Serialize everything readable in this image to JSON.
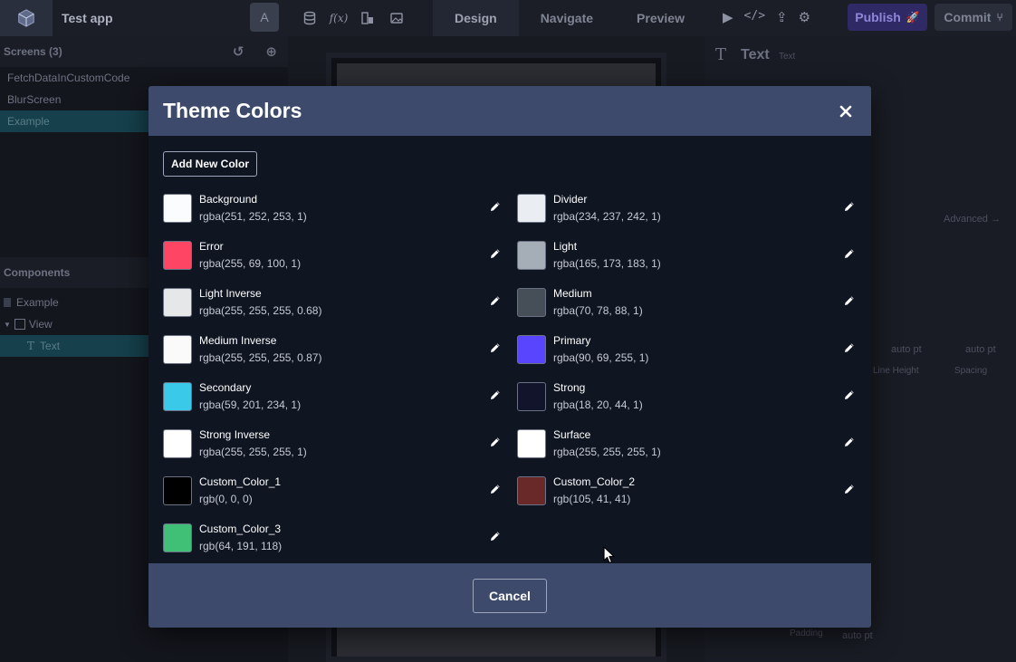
{
  "app": {
    "title": "Test app",
    "avatar_letter": "A",
    "modes": [
      "Design",
      "Navigate",
      "Preview"
    ],
    "active_mode": "Design",
    "publish_label": "Publish",
    "commit_label": "Commit"
  },
  "left_panel": {
    "screens_header": "Screens (3)",
    "screens": [
      "FetchDataInCustomCode",
      "BlurScreen",
      "Example"
    ],
    "active_screen": "Example",
    "components_header": "Components",
    "components": [
      {
        "label": "Example",
        "indent": 0
      },
      {
        "label": "View",
        "indent": 1
      },
      {
        "label": "Text",
        "indent": 2
      }
    ]
  },
  "right_panel": {
    "title": "Text",
    "subtitle": "Text",
    "advanced_label": "Advanced →",
    "line_height_label": "Line Height",
    "spacing_label": "Spacing",
    "padding_label": "Padding",
    "auto_pt": "auto  pt"
  },
  "modal": {
    "title": "Theme Colors",
    "add_button": "Add New Color",
    "cancel_button": "Cancel",
    "colors": [
      {
        "name": "Background",
        "value": "rgba(251, 252, 253, 1)",
        "hex": "#fbfcfd"
      },
      {
        "name": "Divider",
        "value": "rgba(234, 237, 242, 1)",
        "hex": "#eaedf2"
      },
      {
        "name": "Error",
        "value": "rgba(255, 69, 100, 1)",
        "hex": "#ff4564"
      },
      {
        "name": "Light",
        "value": "rgba(165, 173, 183, 1)",
        "hex": "#a5adb7"
      },
      {
        "name": "Light Inverse",
        "value": "rgba(255, 255, 255, 0.68)",
        "hex": "#e6e7e9"
      },
      {
        "name": "Medium",
        "value": "rgba(70, 78, 88, 1)",
        "hex": "#464e58"
      },
      {
        "name": "Medium Inverse",
        "value": "rgba(255, 255, 255, 0.87)",
        "hex": "#fafafa"
      },
      {
        "name": "Primary",
        "value": "rgba(90, 69, 255, 1)",
        "hex": "#5a45ff"
      },
      {
        "name": "Secondary",
        "value": "rgba(59, 201, 234, 1)",
        "hex": "#3bc9ea"
      },
      {
        "name": "Strong",
        "value": "rgba(18, 20, 44, 1)",
        "hex": "#12142c"
      },
      {
        "name": "Strong Inverse",
        "value": "rgba(255, 255, 255, 1)",
        "hex": "#ffffff"
      },
      {
        "name": "Surface",
        "value": "rgba(255, 255, 255, 1)",
        "hex": "#ffffff"
      },
      {
        "name": "Custom_Color_1",
        "value": "rgb(0, 0, 0)",
        "hex": "#000000"
      },
      {
        "name": "Custom_Color_2",
        "value": "rgb(105, 41, 41)",
        "hex": "#692929"
      },
      {
        "name": "Custom_Color_3",
        "value": "rgb(64, 191, 118)",
        "hex": "#40bf76"
      }
    ]
  }
}
